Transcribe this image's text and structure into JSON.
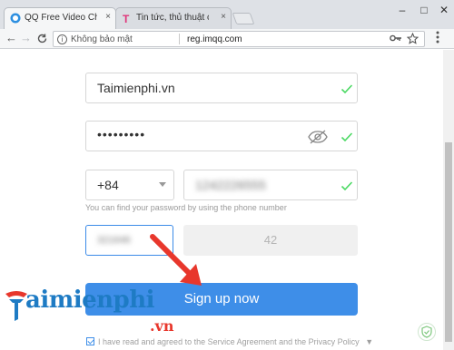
{
  "browser": {
    "tabs": [
      {
        "title": "QQ Free Video Chat, Eng",
        "close": "×"
      },
      {
        "title": "Tin tức, thủ thuật công n",
        "close": "×"
      }
    ],
    "window_controls": {
      "minimize": "–",
      "maximize": "□",
      "close": "✕"
    },
    "nav": {
      "back": "←",
      "forward": "→",
      "reload": "C"
    },
    "address": {
      "security_label": "Không bảo mật",
      "url": "reg.imqq.com",
      "info": "i"
    }
  },
  "form": {
    "username": "Taimienphi.vn",
    "password": "•••••••••",
    "country_code": "+84",
    "phone_number": "1242226555",
    "hint": "You can find your password by using the phone number",
    "verification_code": "321646",
    "resend_countdown": "42",
    "signup_label": "Sign up now",
    "agreement": "I have read and agreed to the Service Agreement and the Privacy Policy",
    "agreement_caret": "▼"
  },
  "watermark": {
    "brand": "aimienphi",
    "suffix": ".vn"
  },
  "colors": {
    "accent": "#3e8ee8",
    "valid": "#4cd964",
    "arrow": "#e8372c"
  }
}
